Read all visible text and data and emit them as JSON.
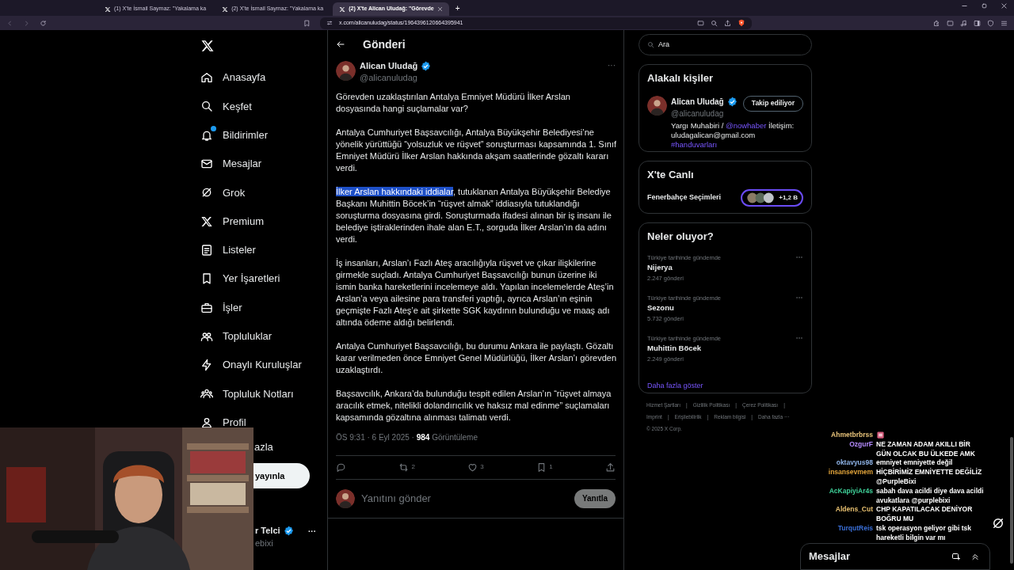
{
  "browser": {
    "tabs": [
      {
        "title": "(1) X'te İsmail Saymaz: \"Yakalama ka",
        "selected": false
      },
      {
        "title": "(2) X'te İsmail Saymaz: \"Yakalama ka",
        "selected": false
      },
      {
        "title": "(2) X'te Alican Uludağ: \"Görevde",
        "selected": true
      }
    ],
    "new_tab": "+",
    "url": "x.com/alicanuludag/status/1964396120664395941"
  },
  "nav": {
    "items": [
      {
        "label": "Anasayfa",
        "badge": false
      },
      {
        "label": "Keşfet",
        "badge": false
      },
      {
        "label": "Bildirimler",
        "badge": true
      },
      {
        "label": "Mesajlar",
        "badge": false
      },
      {
        "label": "Grok",
        "badge": false
      },
      {
        "label": "Premium",
        "badge": false
      },
      {
        "label": "Listeler",
        "badge": false
      },
      {
        "label": "Yer İşaretleri",
        "badge": false
      },
      {
        "label": "İşler",
        "badge": false
      },
      {
        "label": "Topluluklar",
        "badge": false
      },
      {
        "label": "Onaylı Kuruluşlar",
        "badge": false
      },
      {
        "label": "Topluluk Notları",
        "badge": false
      },
      {
        "label": "Profil",
        "badge": false
      }
    ],
    "more_partial": "azla",
    "post_button": "yayınla",
    "account_name": "r Telci",
    "account_handle": "ebixi",
    "account_menu": "···"
  },
  "post": {
    "header": "Gönderi",
    "author": "Alican Uludağ",
    "handle": "@alicanuludag",
    "menu": "···",
    "paragraphs": [
      {
        "text": "Görevden uzaklaştırılan Antalya Emniyet Müdürü İlker Arslan dosyasında hangi suçlamalar var?"
      },
      {
        "text": "Antalya Cumhuriyet Başsavcılığı, Antalya Büyükşehir Belediyesi’ne yönelik yürüttüğü “yolsuzluk ve rüşvet” soruşturması kapsamında 1. Sınıf Emniyet Müdürü İlker Arslan hakkında akşam saatlerinde gözaltı kararı verdi."
      },
      {
        "highlight": "İlker Arslan hakkındaki iddialar",
        "text": ", tutuklanan Antalya Büyükşehir Belediye Başkanı Muhittin Böcek’in “rüşvet almak” iddiasıyla tutuklandığı soruşturma dosyasına girdi. Soruşturmada ifadesi alınan bir iş insanı ile belediye iştiraklerinden ihale alan E.T., sorguda İlker Arslan’ın da adını verdi."
      },
      {
        "text": "İş insanları, Arslan’ı Fazlı Ateş aracılığıyla rüşvet ve çıkar ilişkilerine girmekle suçladı. Antalya Cumhuriyet Başsavcılığı bunun üzerine iki ismin banka hareketlerini incelemeye aldı. Yapılan incelemelerde Ateş’in Arslan’a veya ailesine para transferi yaptığı, ayrıca Arslan’ın eşinin geçmişte Fazlı Ateş’e ait şirkette SGK kaydının bulunduğu ve maaş adı altında ödeme aldığı belirlendi."
      },
      {
        "text": "Antalya Cumhuriyet Başsavcılığı, bu durumu Ankara ile paylaştı. Gözaltı karar verilmeden önce Emniyet Genel Müdürlüğü, İlker Arslan’ı görevden uzaklaştırdı."
      },
      {
        "text": "Başsavcılık, Ankara’da bulunduğu tespit edilen Arslan’ın “rüşvet almaya aracılık etmek, nitelikli dolandırıcılık ve haksız mal edinme” suçlamaları kapsamında gözaltına alınması talimatı verdi."
      }
    ],
    "meta": "ÖS 9:31 · 6 Eyl 2025 · **984** Görüntüleme",
    "action_counts": [
      "2",
      "3",
      "1"
    ],
    "reply_placeholder": "Yanıtını gönder",
    "reply_button": "Yanıtla"
  },
  "sidebar": {
    "search_placeholder": "Ara",
    "related": {
      "title": "Alakalı kişiler",
      "name": "Alican Uludağ",
      "handle": "@alicanuludag",
      "follow_button": "Takip ediliyor",
      "bio": "Yargı Muhabiri / ",
      "bio_link": "@nowhaber",
      "bio_rest": " İletişim: uludagalican@gmail.com",
      "bio_tag": "#handuvarları"
    },
    "live": {
      "title": "X'te Canlı",
      "topic": "Fenerbahçe Seçimleri",
      "count": "+1,2 B"
    },
    "trends": {
      "title": "Neler oluyor?",
      "items": [
        {
          "context": "Türkiye tarihinde gündemde",
          "name": "Nijerya",
          "posts": "2.247 gönderi"
        },
        {
          "context": "Türkiye tarihinde gündemde",
          "name": "Sezonu",
          "posts": "5.732 gönderi"
        },
        {
          "context": "Türkiye tarihinde gündemde",
          "name": "Muhittin Böcek",
          "posts": "2.249 gönderi"
        }
      ],
      "more": "Daha fazla göster"
    },
    "footer": [
      "Hizmet Şartları",
      "|",
      "Gizlilik Politikası",
      "|",
      "Çerez Politikası",
      "|",
      "Imprint",
      "|",
      "Erişilebilirlik",
      "|",
      "Reklam bilgisi",
      "|",
      "Daha fazla ···",
      "© 2025 X Corp."
    ]
  },
  "chat": {
    "messages": [
      {
        "kind": "emote",
        "user": "Ahmetbrbrss",
        "color": "#e8c37a"
      },
      {
        "kind": "text",
        "user": "OzgurF",
        "color": "#b58cff",
        "text": "NE ZAMAN ADAM AKILLI BİR GÜN OLCAK BU ÜLKEDE AMK"
      },
      {
        "kind": "text",
        "user": "oktavyus98",
        "color": "#8fb4e8",
        "text": "emniyet emniyette değil"
      },
      {
        "kind": "text",
        "user": "insansevmem",
        "color": "#e0a33a",
        "text": "HİÇBİRİMİZ EMNİYETTE DEĞİLİZ @PurpleBixi"
      },
      {
        "kind": "text",
        "user": "AcKapiyiAr4s",
        "color": "#3fd29a",
        "text": "sabah dava acildi diye dava acildi avukatlara @purplebixi"
      },
      {
        "kind": "text",
        "user": "Aldens_Cut",
        "color": "#e8c070",
        "text": "CHP KAPATILACAK DENİYOR BOĞRU MU"
      },
      {
        "kind": "text",
        "user": "TurqutReis",
        "color": "#3a6fd8",
        "text": "tsk operasyon geliyor gibi tsk hareketli bilgin var mı"
      }
    ]
  },
  "messages_drawer": {
    "title": "Mesajlar"
  }
}
